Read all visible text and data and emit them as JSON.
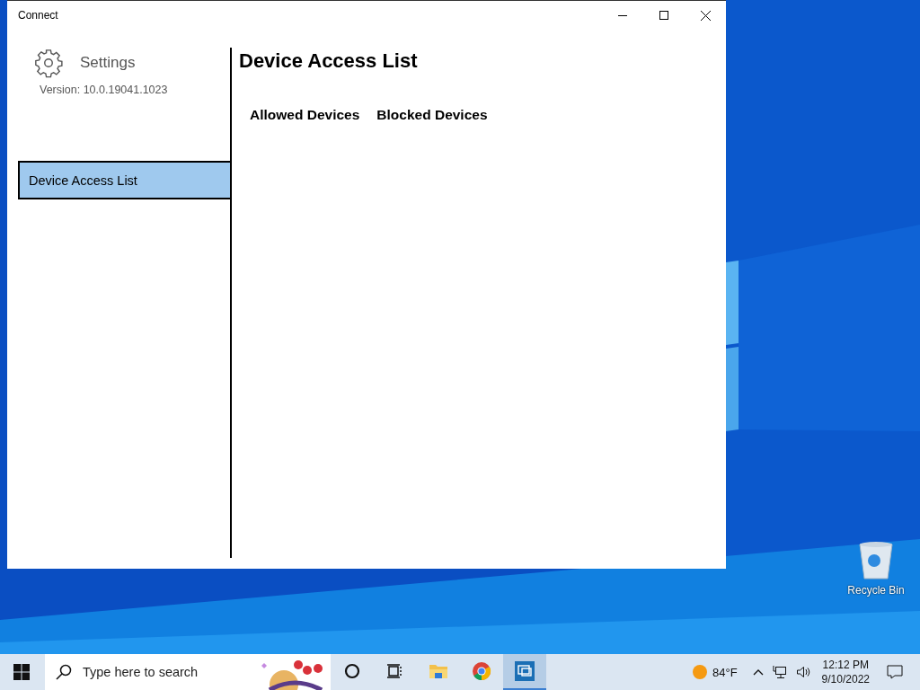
{
  "window": {
    "title": "Connect"
  },
  "sidebar": {
    "header": "Settings",
    "version": "Version: 10.0.19041.1023",
    "items": [
      {
        "label": "Device Access List",
        "selected": true
      }
    ]
  },
  "page": {
    "title": "Device Access List",
    "tabs": [
      "Allowed Devices",
      "Blocked Devices"
    ]
  },
  "desktop": {
    "icons": [
      "Recycle Bin"
    ]
  },
  "taskbar": {
    "search": {
      "placeholder": "Type here to search"
    },
    "apps": [
      {
        "kind": "cortana",
        "selected": false
      },
      {
        "kind": "taskview",
        "selected": false
      },
      {
        "kind": "explorer",
        "selected": false
      },
      {
        "kind": "chrome",
        "selected": false
      },
      {
        "kind": "connect",
        "selected": true
      }
    ],
    "weather": "84°F",
    "time": "12:12 PM",
    "date": "9/10/2022"
  }
}
